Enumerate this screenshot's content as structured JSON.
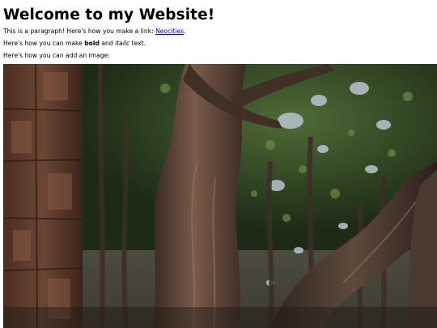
{
  "page": {
    "heading": "Welcome to my Website!",
    "paragraph1": {
      "text_before": "This is a paragraph! Here's how you make a link: ",
      "link_label": "Neocities",
      "text_after": "."
    },
    "paragraph2": {
      "text_before": "Here's how you can make ",
      "bold": "bold",
      "text_middle": " and ",
      "italic": "italic",
      "text_after": " text."
    },
    "paragraph3": {
      "text": "Here's how you can add an image:"
    }
  },
  "colors": {
    "link": "#0000ee",
    "text": "#000000",
    "background": "#ffffff"
  }
}
